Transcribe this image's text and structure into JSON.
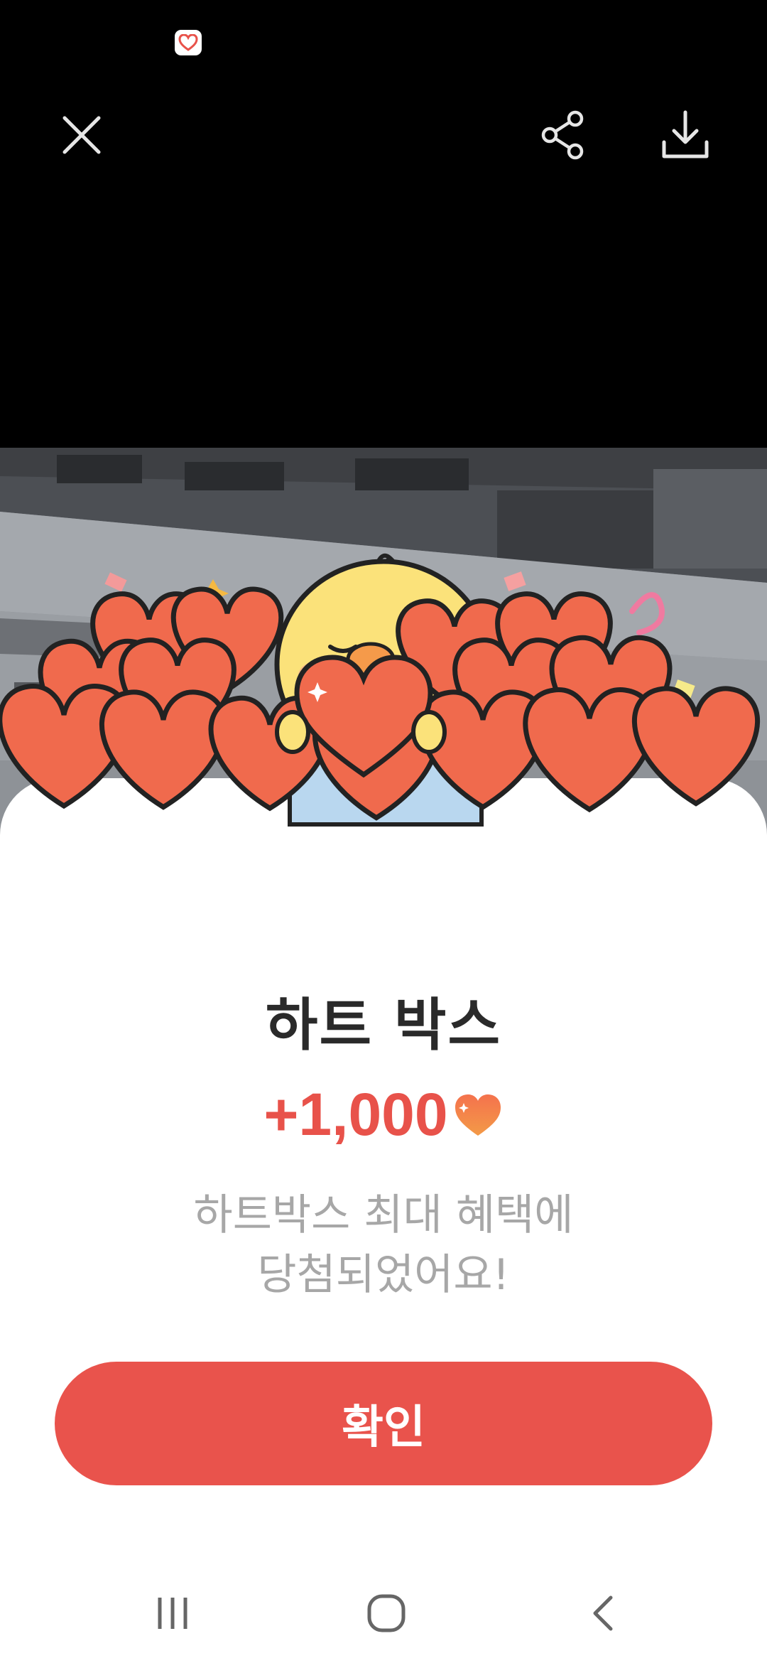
{
  "app": {
    "title": "하트 박스",
    "status_icon": "app-heart-icon"
  },
  "toolbar": {
    "close_icon": "close-icon",
    "share_icon": "share-icon",
    "download_icon": "download-icon"
  },
  "reward": {
    "amount": "+1,000",
    "unit_icon": "heart-icon",
    "message_line1": "하트박스 최대 혜택에",
    "message_line2": "당첨되었어요!"
  },
  "actions": {
    "confirm_label": "확인"
  },
  "nav": {
    "recent_icon": "recent-apps-icon",
    "home_icon": "home-icon",
    "back_icon": "back-icon"
  },
  "colors": {
    "accent": "#e9534c",
    "title_text": "#2a2a2a",
    "muted_text": "#a7a7a7",
    "heart_fill": "#f06a4d",
    "chick_yellow": "#fbe27a"
  }
}
